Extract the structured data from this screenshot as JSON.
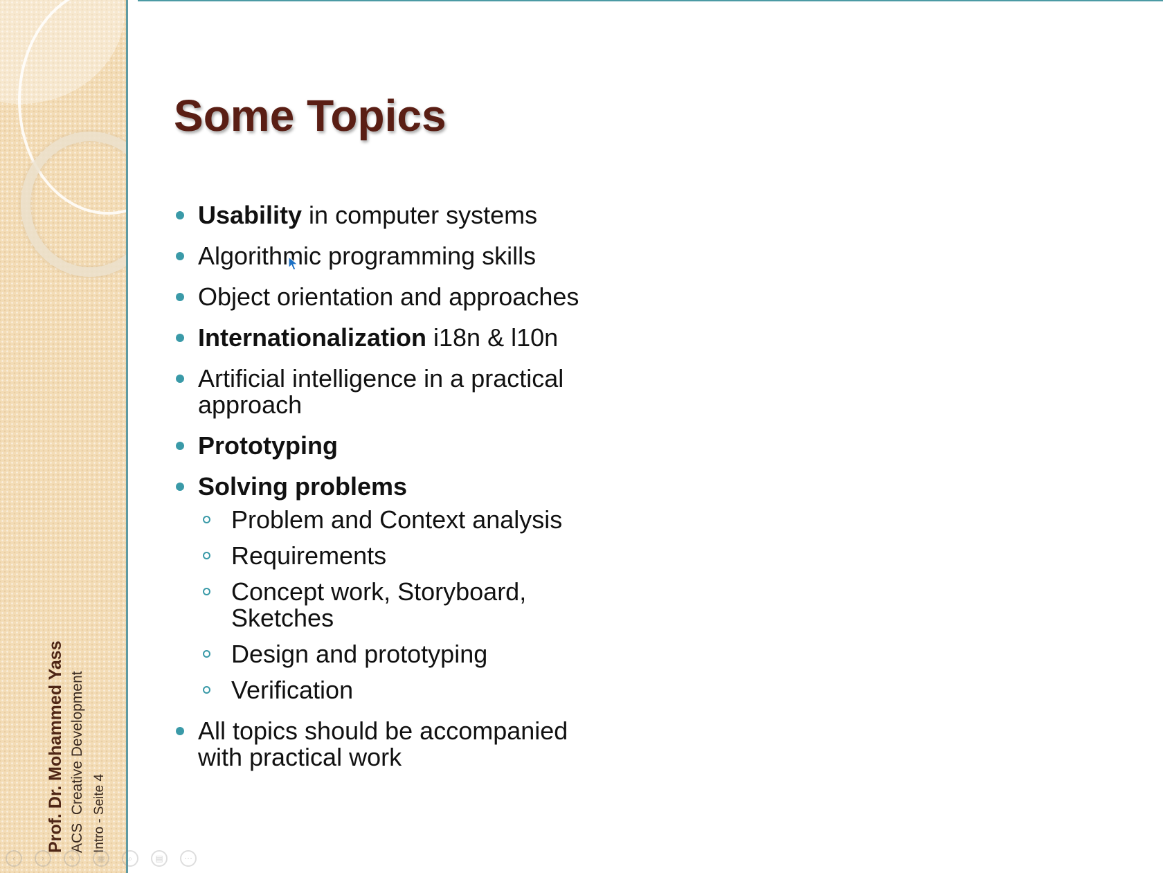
{
  "slide": {
    "title": "Some Topics",
    "topics": [
      {
        "bold": "Usability",
        "rest": " in computer systems"
      },
      {
        "bold": "",
        "rest": "Algorithmic programming skills"
      },
      {
        "bold": "",
        "rest": "Object orientation and approaches"
      },
      {
        "bold": "Internationalization",
        "rest": " i18n & l10n"
      },
      {
        "bold": "",
        "rest": "Artificial intelligence in a practical approach"
      },
      {
        "bold": "Prototyping",
        "rest": ""
      },
      {
        "bold": "Solving problems",
        "rest": ""
      },
      {
        "bold": "",
        "rest": "All topics should be accompanied with practical work"
      }
    ],
    "subtopics": [
      "Problem and Context analysis",
      "Requirements",
      "Concept work, Storyboard, Sketches",
      "Design and prototyping",
      "Verification"
    ]
  },
  "footer": {
    "author": "Prof. Dr. Mohammed Yass",
    "course": "ACS  Creative Development",
    "page": "Intro - Seite 4"
  },
  "controls": [
    {
      "name": "previous-slide-icon",
      "glyph": "‹"
    },
    {
      "name": "next-slide-icon",
      "glyph": "›"
    },
    {
      "name": "pen-icon",
      "glyph": "✎"
    },
    {
      "name": "slides-icon",
      "glyph": "▦"
    },
    {
      "name": "zoom-icon",
      "glyph": "⌕"
    },
    {
      "name": "subtitles-icon",
      "glyph": "▤"
    },
    {
      "name": "more-options-icon",
      "glyph": "⋯"
    }
  ],
  "colors": {
    "title": "#5a1e14",
    "bullet": "#3a9aa8",
    "sidebar": "#f3dcb6",
    "accent_line": "#4b9aa4"
  }
}
